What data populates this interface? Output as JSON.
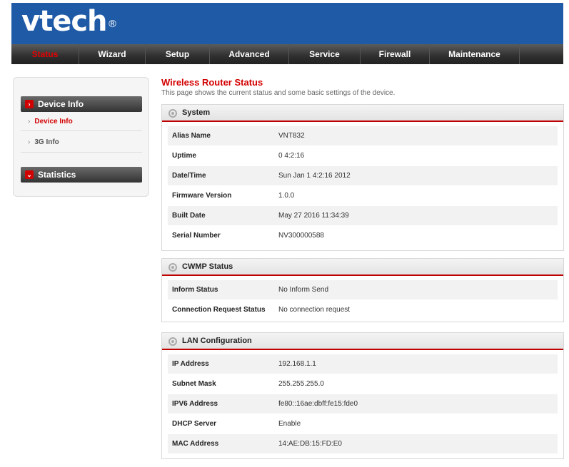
{
  "brand": {
    "logo_text": "vtech",
    "registered": "®",
    "header_color": "#1e5aa6"
  },
  "nav": {
    "items": [
      {
        "label": "Status",
        "active": true
      },
      {
        "label": "Wizard"
      },
      {
        "label": "Setup"
      },
      {
        "label": "Advanced"
      },
      {
        "label": "Service"
      },
      {
        "label": "Firewall"
      },
      {
        "label": "Maintenance"
      }
    ]
  },
  "sidebar": {
    "device_info_header": "Device Info",
    "device_info_link": "Device Info",
    "g3_info_link": "3G Info",
    "statistics_header": "Statistics"
  },
  "page": {
    "title": "Wireless Router Status",
    "subtitle": "This page shows the current status and some basic settings of the device."
  },
  "system": {
    "header": "System",
    "rows": [
      {
        "label": "Alias Name",
        "value": "VNT832"
      },
      {
        "label": "Uptime",
        "value": "0 4:2:16"
      },
      {
        "label": "Date/Time",
        "value": "Sun Jan 1 4:2:16 2012"
      },
      {
        "label": "Firmware Version",
        "value": "1.0.0"
      },
      {
        "label": "Built Date",
        "value": "May 27 2016 11:34:39"
      },
      {
        "label": "Serial Number",
        "value": "NV300000588"
      }
    ]
  },
  "cwmp": {
    "header": "CWMP Status",
    "rows": [
      {
        "label": "Inform Status",
        "value": "No Inform Send"
      },
      {
        "label": "Connection Request Status",
        "value": "No connection request"
      }
    ]
  },
  "lan": {
    "header": "LAN Configuration",
    "rows": [
      {
        "label": "IP Address",
        "value": "192.168.1.1"
      },
      {
        "label": "Subnet Mask",
        "value": "255.255.255.0"
      },
      {
        "label": "IPV6 Address",
        "value": "fe80::16ae:dbff:fe15:fde0"
      },
      {
        "label": "DHCP Server",
        "value": "Enable"
      },
      {
        "label": "MAC Address",
        "value": "14:AE:DB:15:FD:E0"
      }
    ]
  },
  "colors": {
    "accent": "#d40000",
    "nav_bg": "#2f2f2f"
  }
}
